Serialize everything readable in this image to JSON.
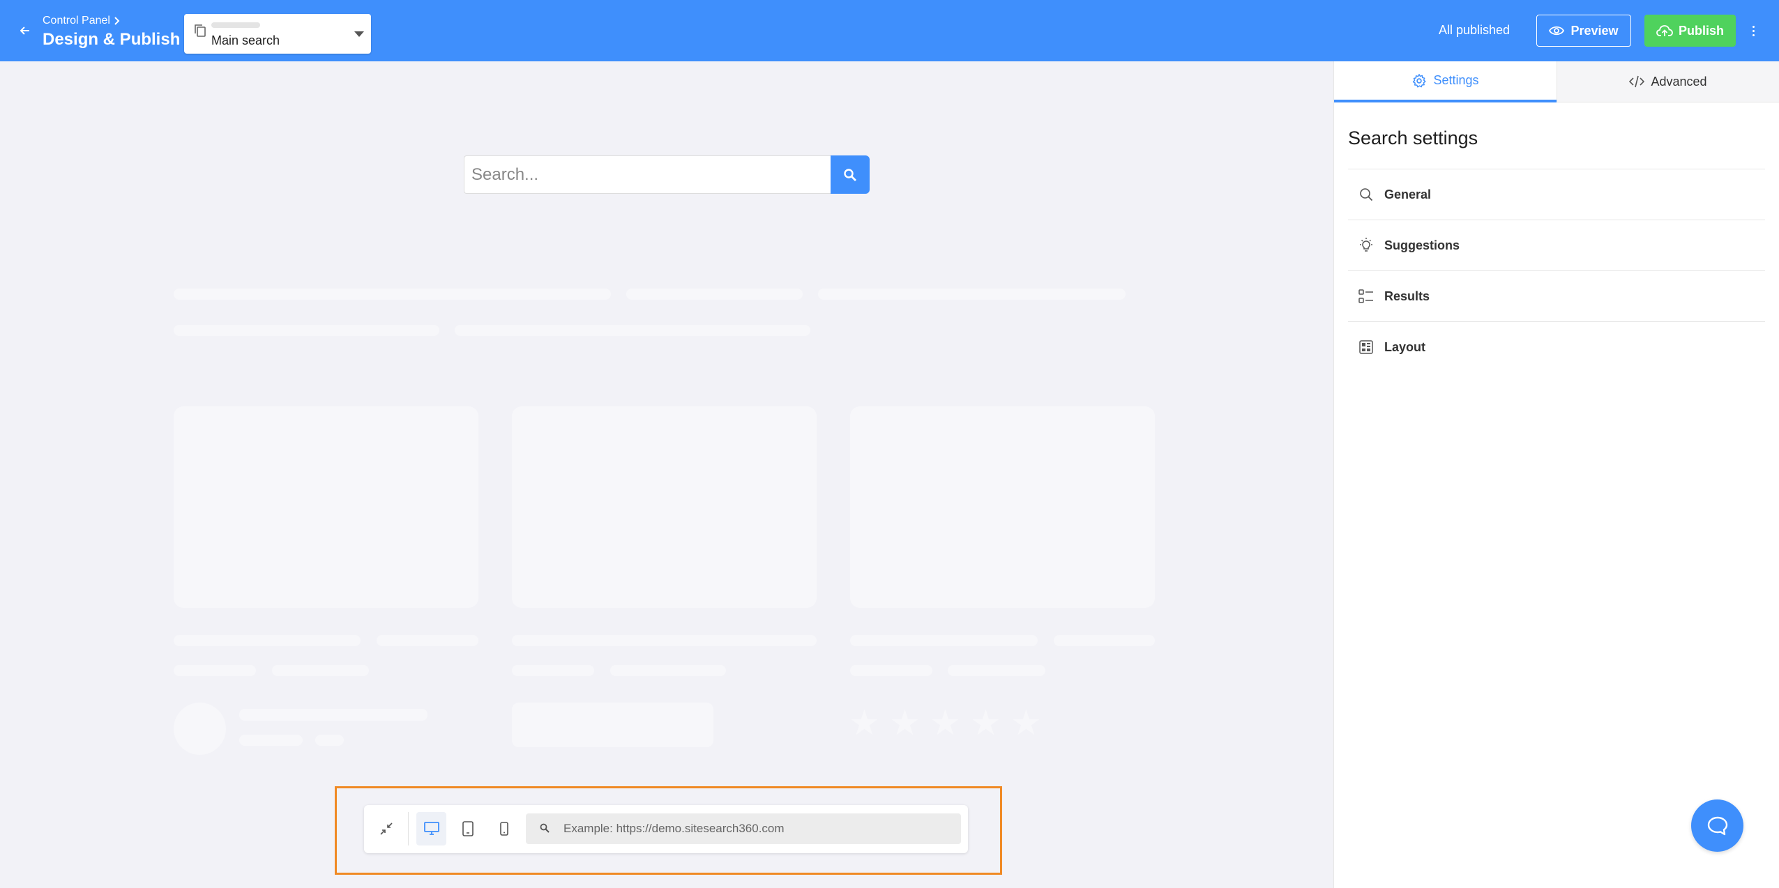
{
  "header": {
    "breadcrumb": "Control Panel",
    "title": "Design & Publish",
    "search_select": {
      "value": "Main search"
    },
    "status": "All published",
    "preview_label": "Preview",
    "publish_label": "Publish"
  },
  "canvas": {
    "search_placeholder": "Search..."
  },
  "device_bar": {
    "url_placeholder": "Example: https://demo.sitesearch360.com",
    "active_device": "desktop"
  },
  "panel": {
    "tabs": [
      {
        "label": "Settings",
        "icon": "gear-icon",
        "active": true
      },
      {
        "label": "Advanced",
        "icon": "code-icon",
        "active": false
      }
    ],
    "title": "Search settings",
    "sections": [
      {
        "label": "General",
        "icon": "search-icon"
      },
      {
        "label": "Suggestions",
        "icon": "lightbulb-icon"
      },
      {
        "label": "Results",
        "icon": "list-icon"
      },
      {
        "label": "Layout",
        "icon": "layout-icon"
      }
    ]
  },
  "colors": {
    "brand": "#3f8ffc",
    "publish": "#4fd25d",
    "highlight": "#f08a24"
  }
}
